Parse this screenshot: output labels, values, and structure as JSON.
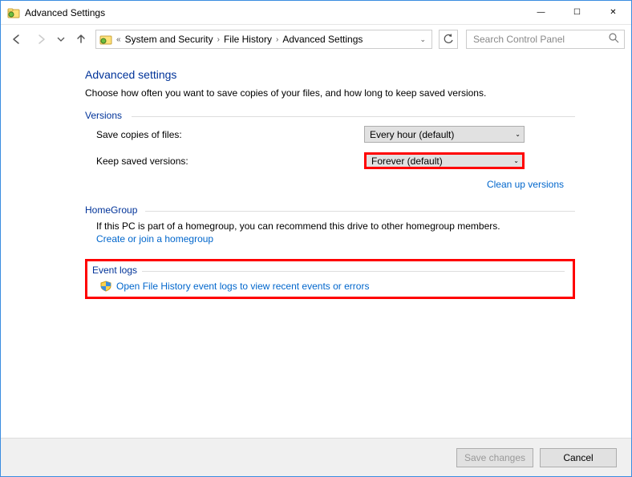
{
  "window": {
    "title": "Advanced Settings",
    "minimize": "—",
    "maximize": "☐",
    "close": "✕"
  },
  "breadcrumb": {
    "prefix": "«",
    "segments": [
      "System and Security",
      "File History",
      "Advanced Settings"
    ]
  },
  "search": {
    "placeholder": "Search Control Panel"
  },
  "page": {
    "title": "Advanced settings",
    "desc": "Choose how often you want to save copies of your files, and how long to keep saved versions."
  },
  "versions": {
    "header": "Versions",
    "save_label": "Save copies of files:",
    "save_value": "Every hour (default)",
    "keep_label": "Keep saved versions:",
    "keep_value": "Forever (default)",
    "cleanup_link": "Clean up versions"
  },
  "homegroup": {
    "header": "HomeGroup",
    "desc": "If this PC is part of a homegroup, you can recommend this drive to other homegroup members.",
    "link": "Create or join a homegroup"
  },
  "eventlogs": {
    "header": "Event logs",
    "link": "Open File History event logs to view recent events or errors"
  },
  "footer": {
    "save": "Save changes",
    "cancel": "Cancel"
  }
}
